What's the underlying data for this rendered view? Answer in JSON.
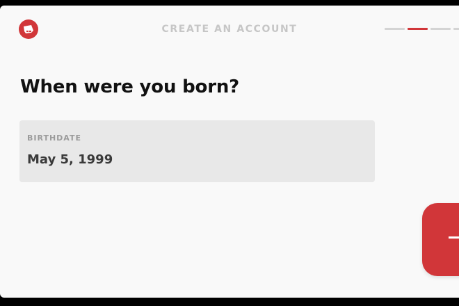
{
  "header": {
    "title": "CREATE AN ACCOUNT",
    "logo_icon": "riot-fist-icon",
    "progress": {
      "total_steps": 4,
      "current_step": 2
    }
  },
  "main": {
    "question": "When were you born?",
    "birthdate_field": {
      "label": "BIRTHDATE",
      "value": "May 5, 1999"
    }
  },
  "next_button": {
    "icon": "arrow-right-icon"
  },
  "colors": {
    "accent": "#d13639",
    "background": "#f9f9f9",
    "field_background": "#e8e8e8",
    "header_text": "#c6c6c6"
  }
}
